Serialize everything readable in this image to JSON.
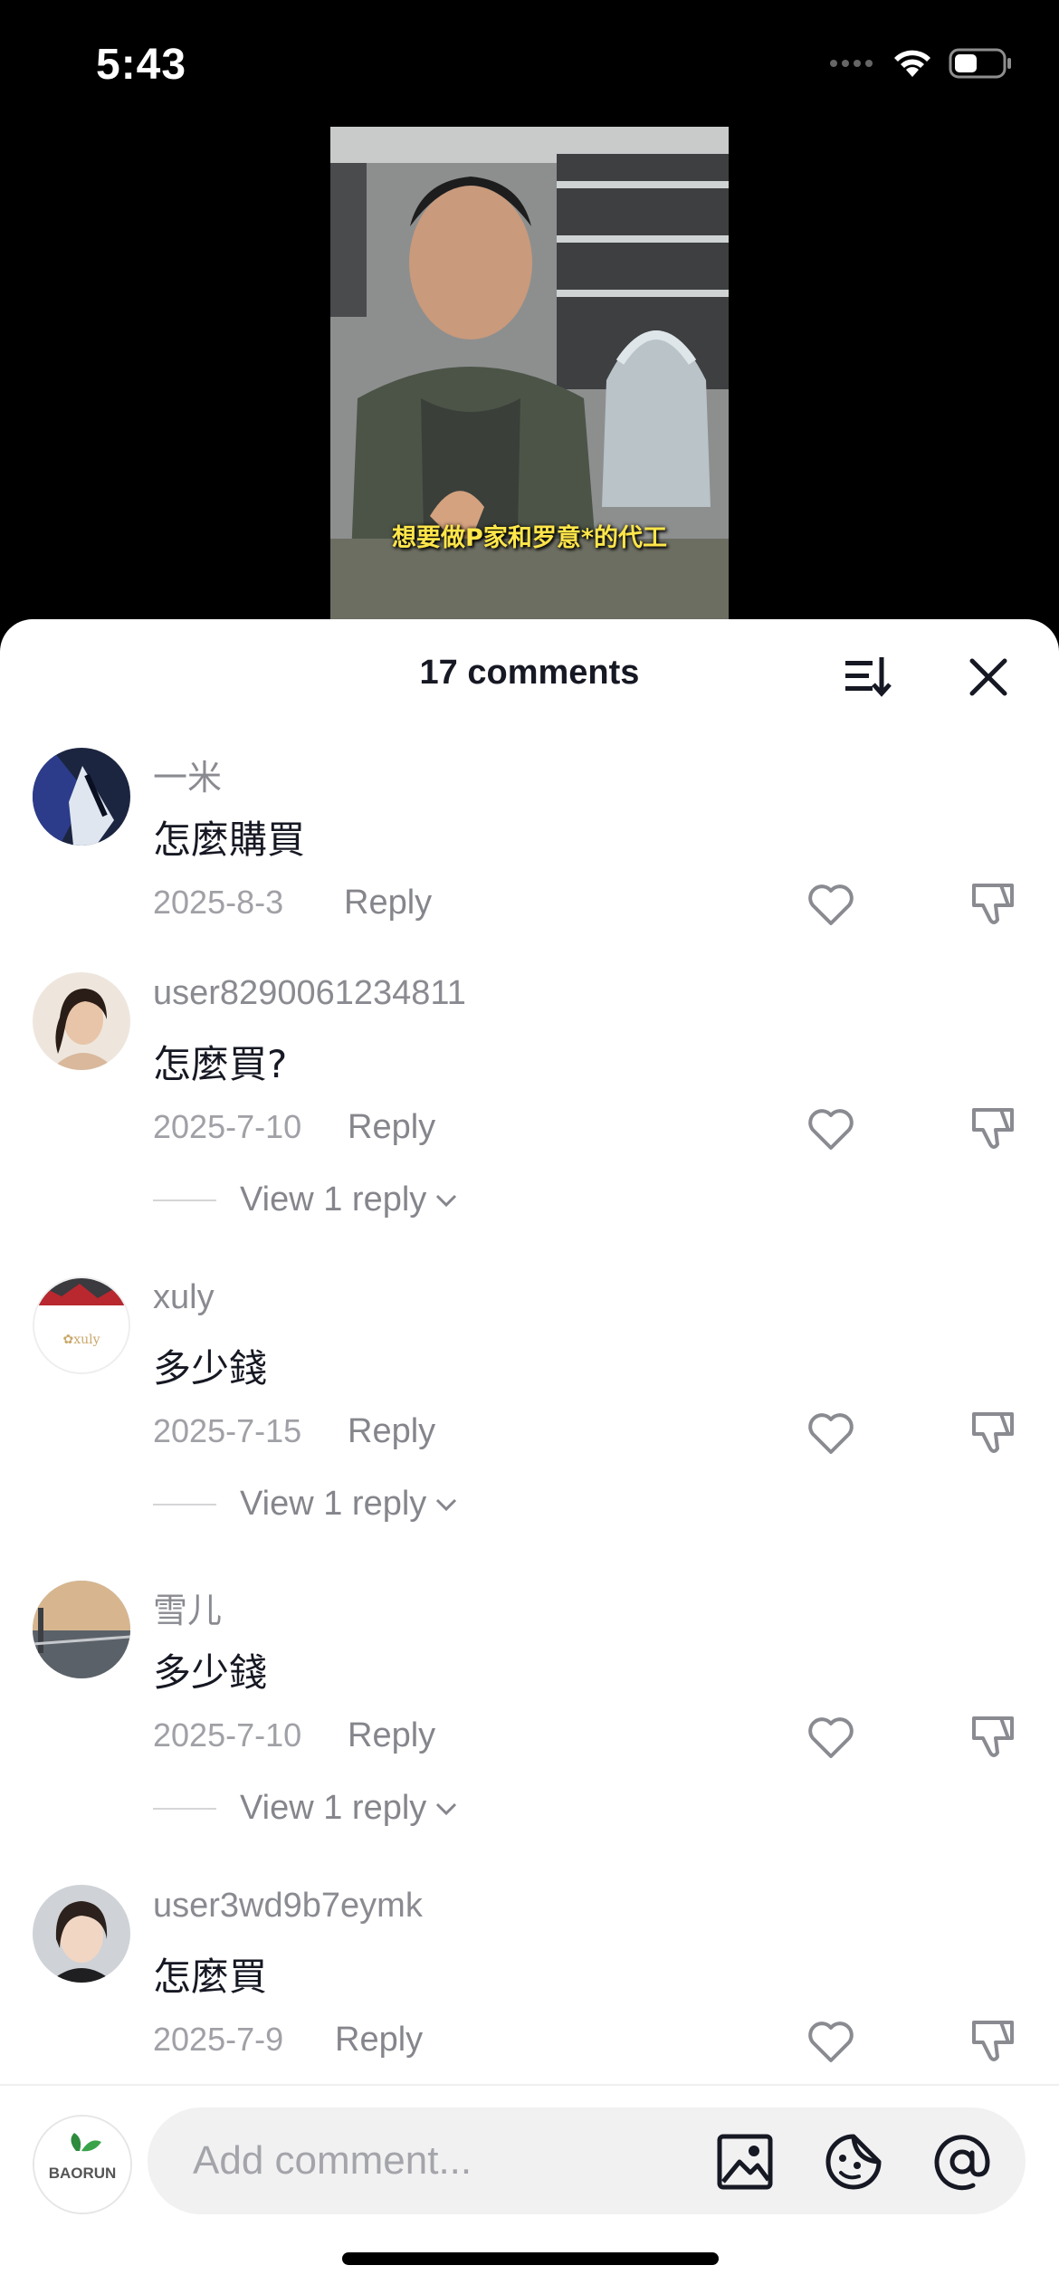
{
  "status_bar": {
    "time": "5:43"
  },
  "video": {
    "caption": "想要做P家和罗意*的代工"
  },
  "comments_panel": {
    "count_label": "17 comments",
    "sort_icon": "sort-icon",
    "close_icon": "close-icon"
  },
  "comments": [
    {
      "username": "一米",
      "text": "怎麼購買",
      "date": "2025-8-3",
      "reply_label": "Reply"
    },
    {
      "username": "user8290061234811",
      "text": "怎麼買?",
      "date": "2025-7-10",
      "reply_label": "Reply",
      "view_replies": "View 1 reply"
    },
    {
      "username": "xuly",
      "text": "多少錢",
      "date": "2025-7-15",
      "reply_label": "Reply",
      "view_replies": "View 1 reply"
    },
    {
      "username": "雪儿",
      "text": "多少錢",
      "date": "2025-7-10",
      "reply_label": "Reply",
      "view_replies": "View 1 reply"
    },
    {
      "username": "user3wd9b7eymk",
      "text": "怎麼買",
      "date": "2025-7-9",
      "reply_label": "Reply"
    }
  ],
  "composer": {
    "placeholder": "Add comment...",
    "avatar_text": "BAORUN",
    "icons": [
      "image-icon",
      "sticker-icon",
      "mention-icon"
    ]
  },
  "colors": {
    "accent_text": "#161823",
    "secondary_text": "#8a8b91",
    "background": "#ffffff",
    "caption": "#ffe64a"
  }
}
